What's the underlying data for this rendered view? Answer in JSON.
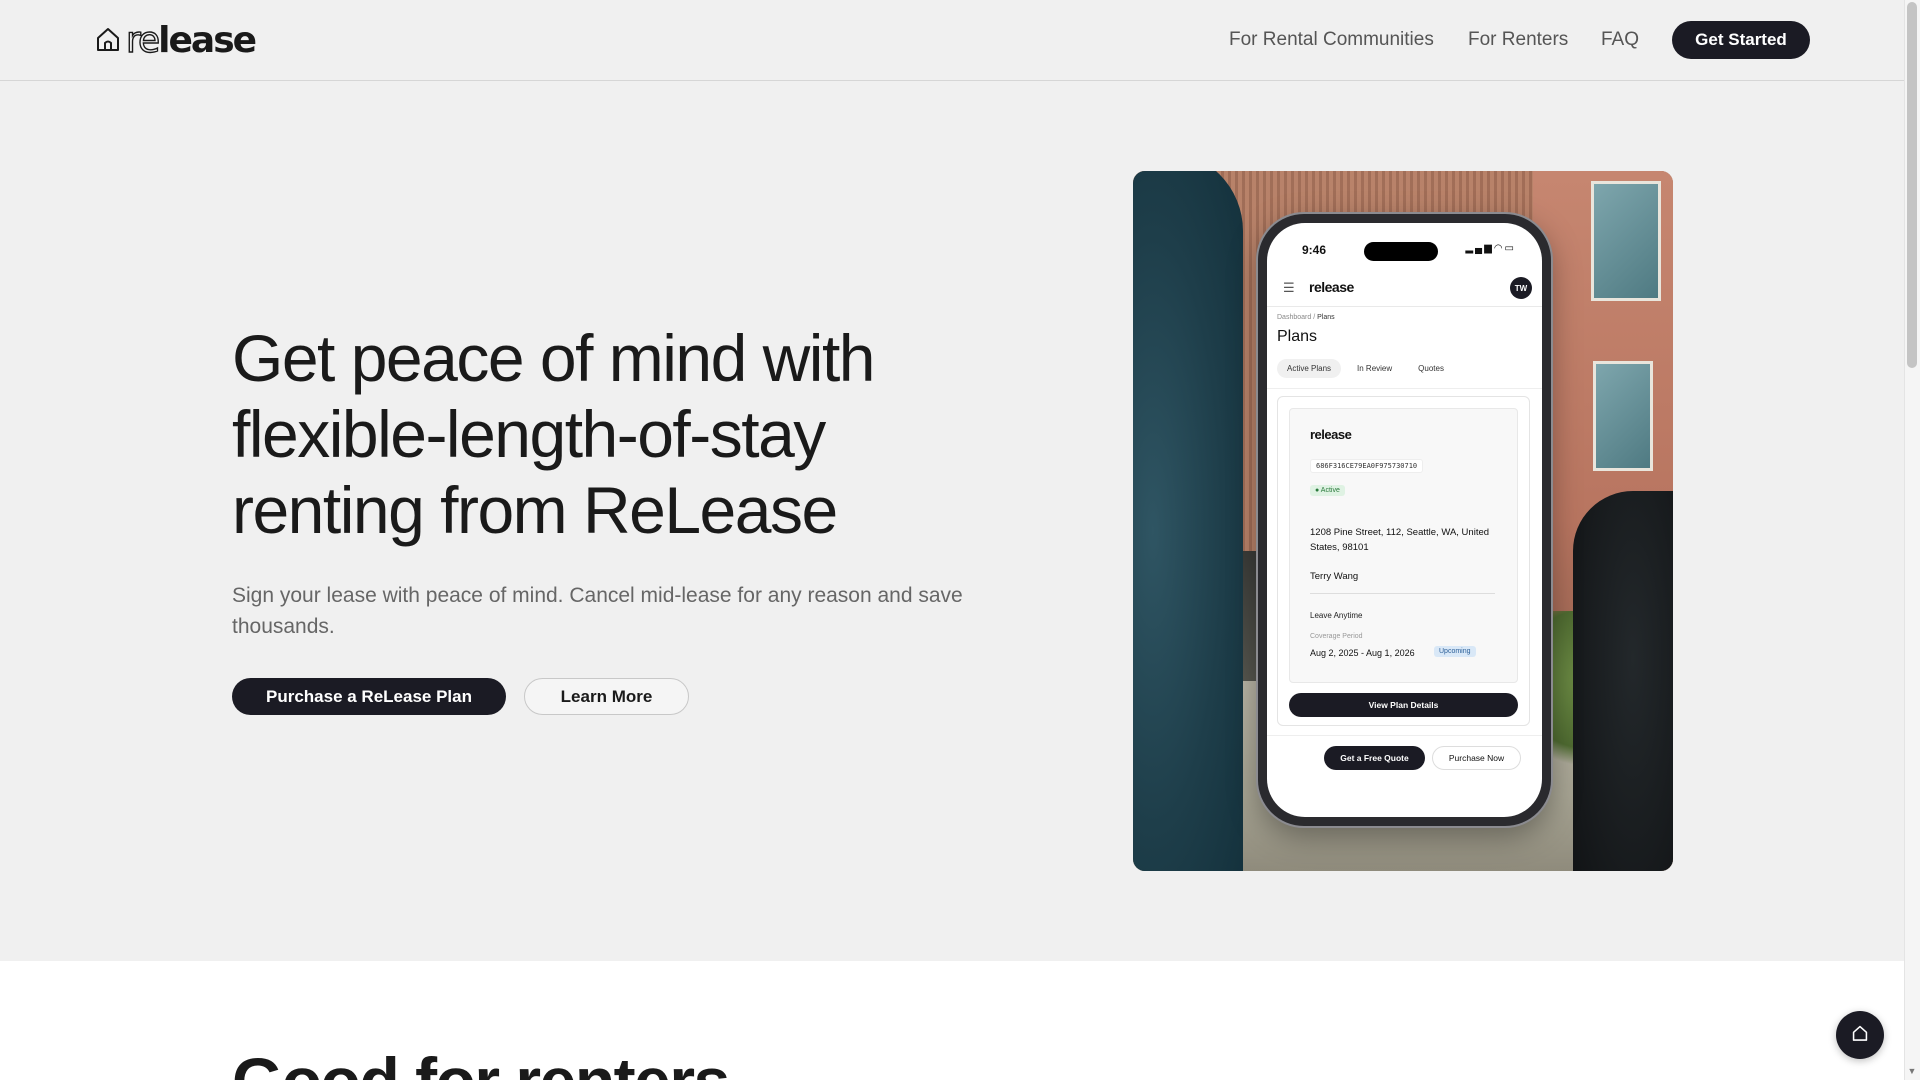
{
  "header": {
    "logo_re": "re",
    "logo_lease": "lease",
    "nav": [
      {
        "label": "For Rental Communities"
      },
      {
        "label": "For Renters"
      },
      {
        "label": "FAQ"
      }
    ],
    "cta_label": "Get Started"
  },
  "hero": {
    "title_lines": [
      "Get peace of mind with",
      "flexible-length-of-stay",
      "renting from ReLease"
    ],
    "subtitle": "Sign your lease with peace of mind. Cancel mid-lease for any reason and save thousands.",
    "primary_button": "Purchase a ReLease Plan",
    "secondary_button": "Learn More"
  },
  "phone": {
    "time": "9:46",
    "app_logo": "release",
    "avatar_initials": "TW",
    "breadcrumb_parent": "Dashboard",
    "breadcrumb_current": "Plans",
    "page_title": "Plans",
    "tabs": [
      {
        "label": "Active Plans",
        "active": true
      },
      {
        "label": "In Review",
        "active": false
      },
      {
        "label": "Quotes",
        "active": false
      }
    ],
    "card": {
      "logo": "release",
      "code": "686F316CE79EA0F975730710",
      "status": "Active",
      "address": "1208 Pine Street, 112, Seattle, WA, United States, 98101",
      "name": "Terry Wang",
      "plan_type": "Leave Anytime",
      "coverage_label": "Coverage Period",
      "coverage_value": "Aug 2, 2025 - Aug 1, 2026",
      "coverage_badge": "Upcoming",
      "view_button": "View Plan Details"
    },
    "quote_button": "Get a Free Quote",
    "purchase_button": "Purchase Now"
  },
  "lower": {
    "title": "Good for renters"
  },
  "colors": {
    "background": "#f0f0f0",
    "primary_dark": "#1b1b24",
    "text": "#1a1a1a",
    "muted": "#666666"
  },
  "icons": {
    "logo": "house-outline-icon",
    "chat": "house-outline-icon",
    "menu": "hamburger-menu-icon"
  }
}
